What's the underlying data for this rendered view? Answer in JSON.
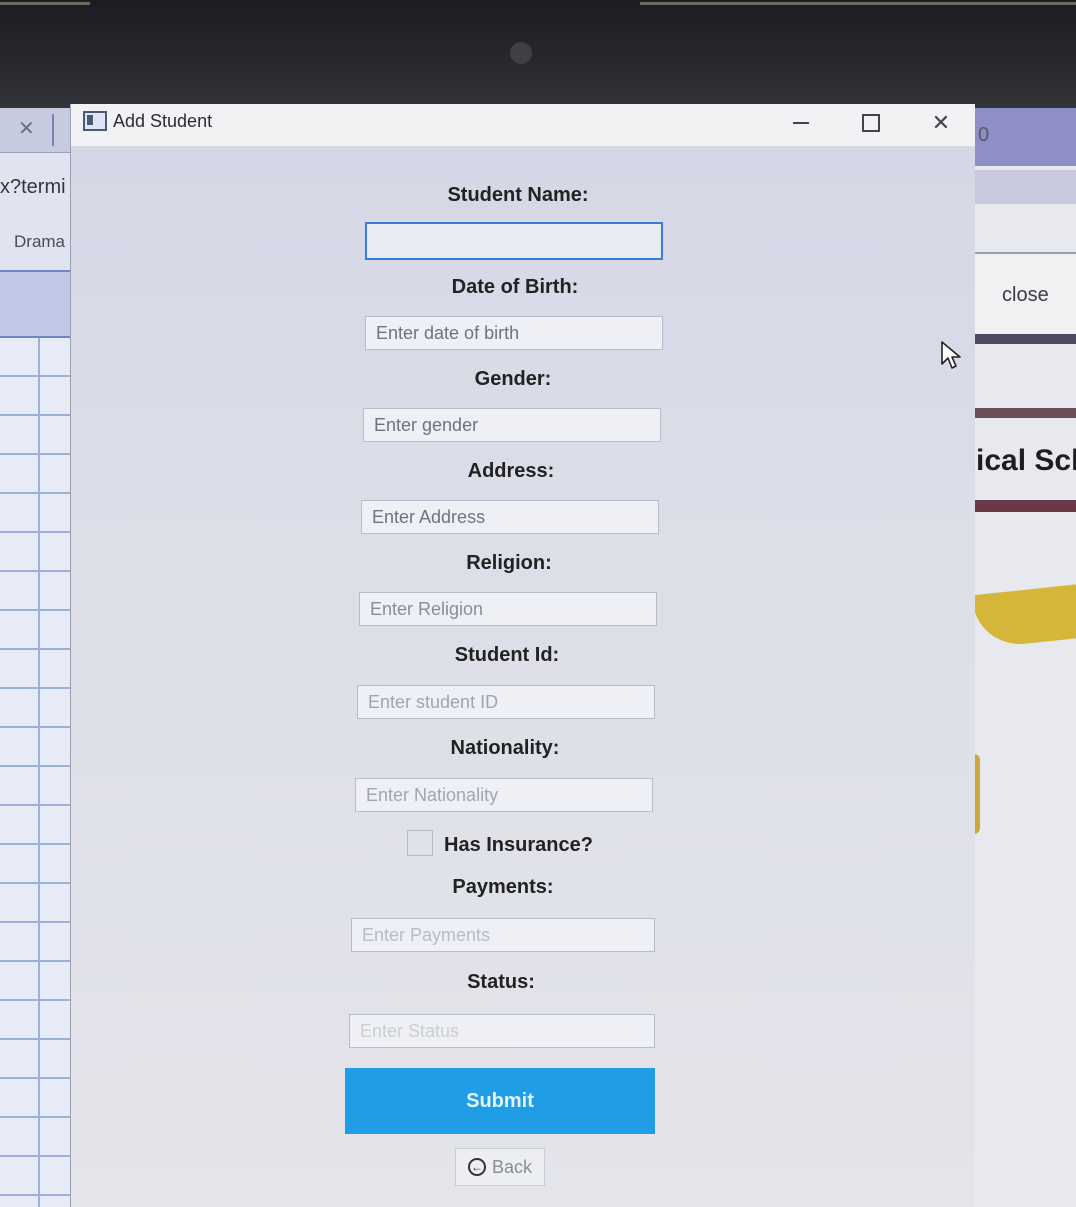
{
  "background_left": {
    "url_fragment": "x?termi",
    "menu_item": "Drama"
  },
  "background_right": {
    "count": "0",
    "close_label": "close",
    "heading_fragment": "ical Sch"
  },
  "window": {
    "title": "Add Student",
    "icon": "app-window-icon"
  },
  "form": {
    "student_name": {
      "label": "Student Name:",
      "value": "",
      "placeholder": ""
    },
    "date_of_birth": {
      "label": "Date of Birth:",
      "placeholder": "Enter date of birth"
    },
    "gender": {
      "label": "Gender:",
      "placeholder": "Enter gender"
    },
    "address": {
      "label": "Address:",
      "placeholder": "Enter Address"
    },
    "religion": {
      "label": "Religion:",
      "placeholder": "Enter Religion"
    },
    "student_id": {
      "label": "Student Id:",
      "placeholder": "Enter student ID"
    },
    "nationality": {
      "label": "Nationality:",
      "placeholder": "Enter Nationality"
    },
    "has_insurance": {
      "label": "Has Insurance?",
      "checked": false
    },
    "payments": {
      "label": "Payments:",
      "placeholder": "Enter Payments"
    },
    "status": {
      "label": "Status:",
      "placeholder": "Enter Status"
    },
    "submit_label": "Submit",
    "back_label": "Back"
  },
  "colors": {
    "submit_bg": "#1f9ee6",
    "focus_border": "#3a7bd5"
  }
}
